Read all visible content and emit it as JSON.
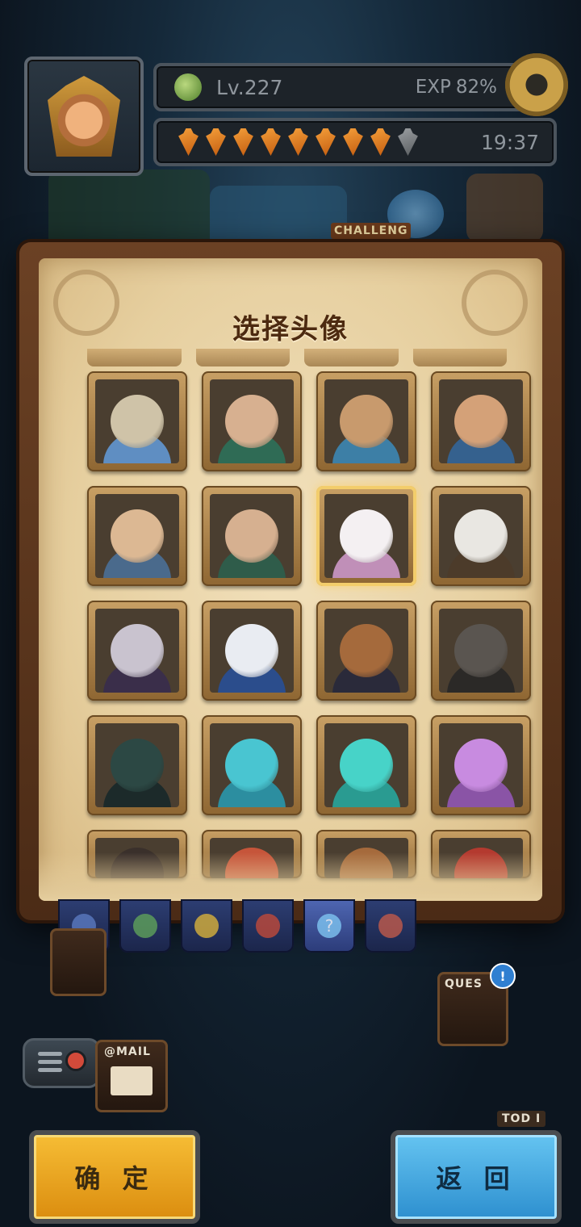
{
  "header": {
    "level": "Lv.227",
    "exp_label": "EXP",
    "exp_value": "82%",
    "carrots_full": 8,
    "carrots_total": 9,
    "timer": "19:37"
  },
  "map": {
    "challenge_label": "CHALLENG",
    "quest_label": "QUES",
    "quest_badge": "!",
    "mail_label": "@MAIL",
    "tod_label": "TOD I"
  },
  "dialog": {
    "title": "选择头像",
    "selected_index": 6,
    "avatars": [
      {
        "name": "bear",
        "head": "#cfc3a8",
        "body": "#5f8ec2"
      },
      {
        "name": "old-man-green",
        "head": "#d7b090",
        "body": "#2f6b55"
      },
      {
        "name": "bald-man-blue",
        "head": "#c89a6d",
        "body": "#3d7fa6"
      },
      {
        "name": "mustache-man",
        "head": "#d4a178",
        "body": "#35618e"
      },
      {
        "name": "scholar-blue",
        "head": "#dcb893",
        "body": "#4a6a8c"
      },
      {
        "name": "scholar-green",
        "head": "#d6b090",
        "body": "#2f5c4a"
      },
      {
        "name": "bunny-girl",
        "head": "#f4f0f2",
        "body": "#c08fb8"
      },
      {
        "name": "pirate-skull",
        "head": "#e9e7e2",
        "body": "#4c3b2a"
      },
      {
        "name": "purple-knight",
        "head": "#c9c3cf",
        "body": "#3a2e4a"
      },
      {
        "name": "astronaut",
        "head": "#e9ecf2",
        "body": "#2b4d8c"
      },
      {
        "name": "monkey",
        "head": "#a56a3c",
        "body": "#2a2a3a"
      },
      {
        "name": "dark-knight",
        "head": "#5a5550",
        "body": "#2b2927"
      },
      {
        "name": "shadow-beast",
        "head": "#2c4844",
        "body": "#1c2a2a"
      },
      {
        "name": "blue-slime-crown",
        "head": "#49c5d1",
        "body": "#2c8ea0"
      },
      {
        "name": "blue-slime-flowers",
        "head": "#47d3c8",
        "body": "#2a9b91"
      },
      {
        "name": "purple-slime",
        "head": "#c88be0",
        "body": "#8a54a6"
      }
    ],
    "partial_row": [
      {
        "name": "dark-hair",
        "head": "#3a302b"
      },
      {
        "name": "cowboy-hat",
        "head": "#c6553a"
      },
      {
        "name": "monkey-2",
        "head": "#a56a3c"
      },
      {
        "name": "red-demon",
        "head": "#b43a2f"
      }
    ]
  },
  "tabs": [
    {
      "name": "tab-blue-hero",
      "color": "#5b7bc0"
    },
    {
      "name": "tab-green-hero",
      "color": "#5fa25a"
    },
    {
      "name": "tab-yellow-hero",
      "color": "#d8b23b"
    },
    {
      "name": "tab-red-hero",
      "color": "#c04a3a"
    },
    {
      "name": "tab-mystery",
      "label": "?"
    },
    {
      "name": "tab-fox-hero",
      "color": "#c05a4a"
    }
  ],
  "buttons": {
    "confirm": "确 定",
    "back": "返 回"
  }
}
